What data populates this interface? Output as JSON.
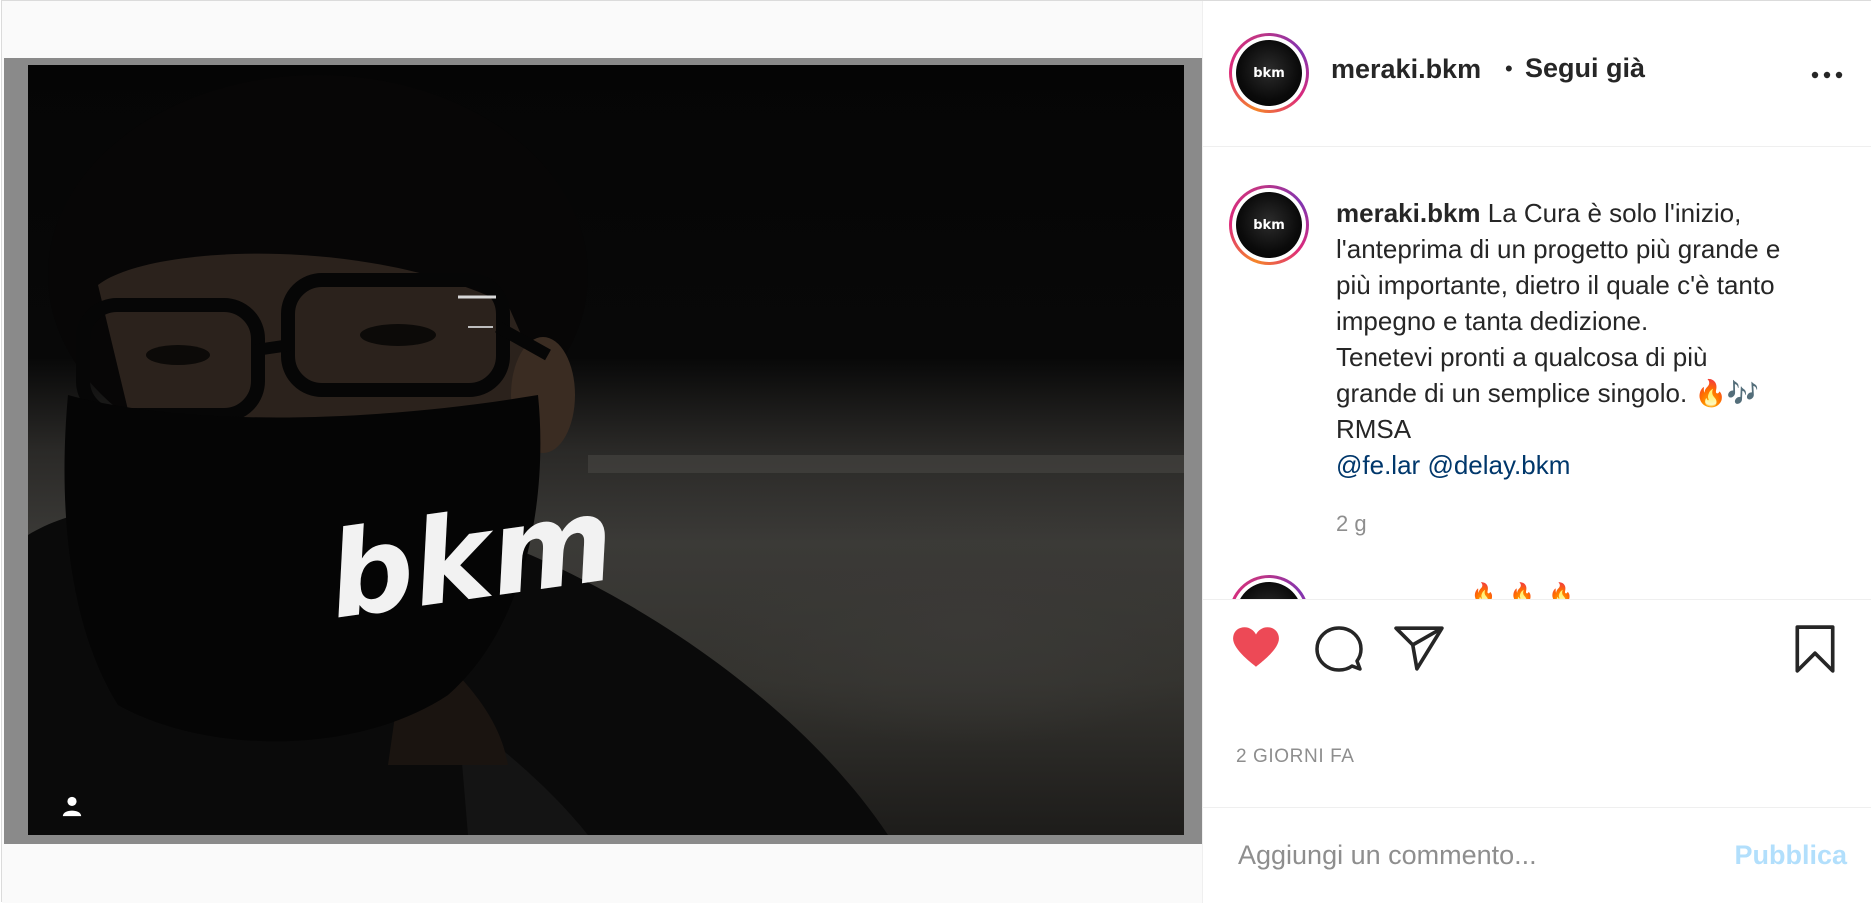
{
  "post": {
    "username": "meraki.bkm",
    "separator": "•",
    "follow_status": "Segui già",
    "more_icon": "more-horizontal-icon",
    "mask_logo_text": "bkm"
  },
  "caption": {
    "username": "meraki.bkm",
    "lines": [
      "La Cura è solo l'inizio,",
      "l'anteprima di un progetto più grande e",
      "più importante, dietro il quale c'è tanto",
      "impegno e tanta dedizione.",
      "Tenetevi pronti a qualcosa di più",
      "grande di un semplice singolo. 🔥🎶",
      "RMSA"
    ],
    "mentions": [
      "@fe.lar",
      "@delay.bkm"
    ],
    "time": "2 g"
  },
  "next_comment": {
    "partial_text": "🔥🔥🔥"
  },
  "actions": {
    "liked": true,
    "like_color": "#ed4956",
    "time_ago": "2 GIORNI FA"
  },
  "comment_box": {
    "placeholder": "Aggiungi un commento...",
    "publish_label": "Pubblica",
    "publish_color": "#b2dffc"
  },
  "colors": {
    "text": "#262626",
    "secondary": "#8e8e8e",
    "mention": "#00376b"
  }
}
